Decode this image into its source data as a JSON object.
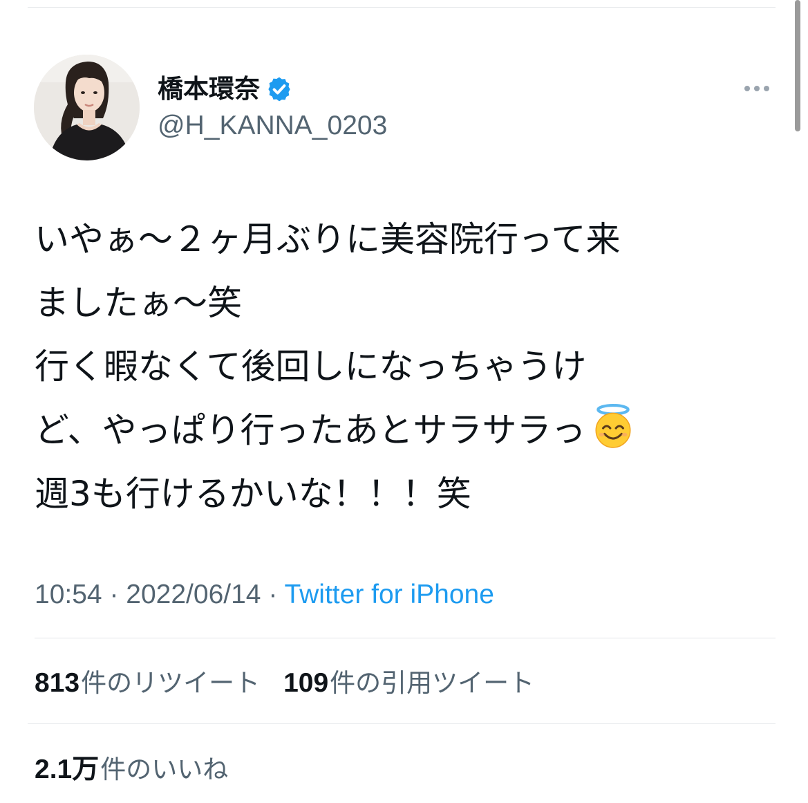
{
  "tweet": {
    "author": {
      "display_name": "橋本環奈",
      "handle": "@H_KANNA_0203",
      "verified": true
    },
    "more_icon": "more-horizontal-icon",
    "body_lines": [
      "いやぁ～２ヶ月ぶりに美容院行って来",
      "ましたぁ～笑",
      "行く暇なくて後回しになっちゃうけ",
      "ど、やっぱり行ったあとサラサラっ",
      "週3も行けるかいな！！！笑"
    ],
    "body_emoji": "smiling-face-with-halo-emoji",
    "time": "10:54",
    "separator": " · ",
    "date": "2022/06/14",
    "source": "Twitter for iPhone",
    "stats": {
      "retweets_count": "813",
      "retweets_label": "件のリツイート",
      "quotes_count": "109",
      "quotes_label": "件の引用ツイート",
      "likes_count": "2.1万",
      "likes_label": "件のいいね"
    }
  },
  "colors": {
    "text_primary": "#0f1419",
    "text_secondary": "#536471",
    "link_blue": "#1d9bf0",
    "verified_blue": "#1d9bf0",
    "divider": "#e3e6e9"
  }
}
